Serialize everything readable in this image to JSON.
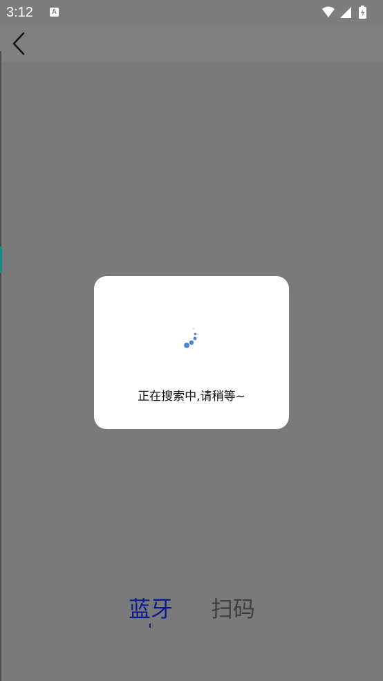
{
  "status_bar": {
    "time": "3:12",
    "notification_icon": "A",
    "icons": [
      "wifi-icon",
      "signal-icon",
      "battery-charging-icon"
    ]
  },
  "toolbar": {
    "back_icon": "chevron-left-icon"
  },
  "dialog": {
    "message": "正在搜索中,请稍等~",
    "spinner_icon": "loading-spinner-icon",
    "accent_color": "#4a86d8"
  },
  "tabs": [
    {
      "label": "蓝牙",
      "active": true,
      "color": "#0a1a8f"
    },
    {
      "label": "扫码",
      "active": false,
      "color": "#3f3f3f"
    }
  ]
}
